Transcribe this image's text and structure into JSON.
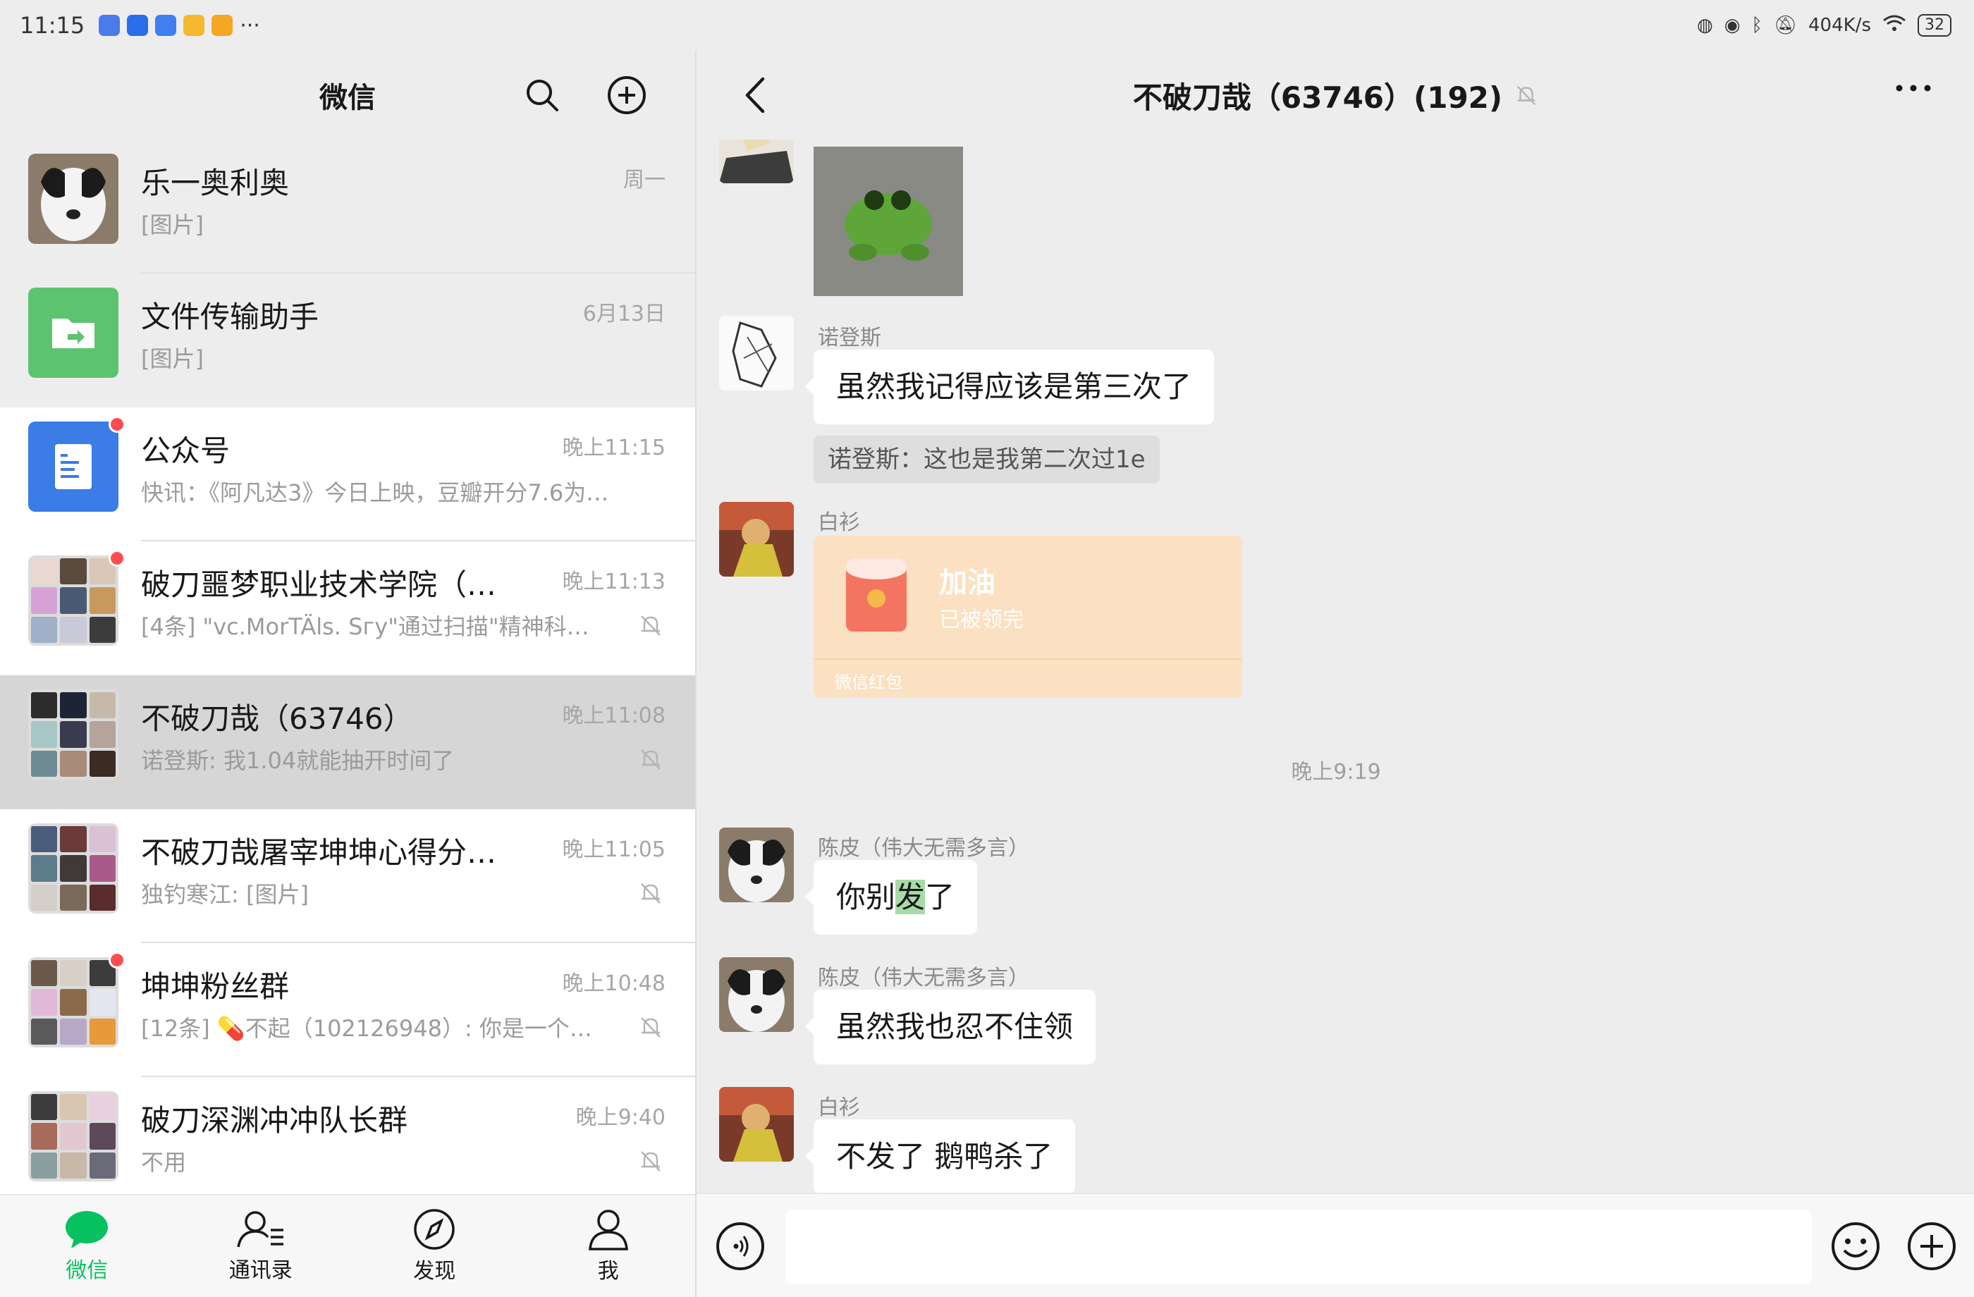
{
  "status_bar": {
    "time": "11:15",
    "ellipsis": "···",
    "net_speed": "404K/s",
    "battery": "32"
  },
  "left_header": {
    "title": "微信"
  },
  "chats": [
    {
      "name": "乐一奥利奥",
      "preview": "[图片]",
      "time": "周一",
      "muted": false,
      "unread": false
    },
    {
      "name": "文件传输助手",
      "preview": "[图片]",
      "time": "6月13日",
      "muted": false,
      "unread": false
    },
    {
      "name": "公众号",
      "preview": "快讯：《阿凡达3》今日上映，豆瓣开分7.6为…",
      "time": "晚上11:15",
      "muted": false,
      "unread": true
    },
    {
      "name": "破刀噩梦职业技术学院（…",
      "preview": "[4条] \"vc.MorTÄls. Sгу\"通过扫描\"精神科主…",
      "time": "晚上11:13",
      "muted": true,
      "unread": true
    },
    {
      "name": "不破刀哉（63746）",
      "preview": "诺登斯: 我1.04就能抽开时间了",
      "time": "晚上11:08",
      "muted": true,
      "unread": false
    },
    {
      "name": "不破刀哉屠宰坤坤心得分…",
      "preview": "独钓寒江: [图片]",
      "time": "晚上11:05",
      "muted": true,
      "unread": false
    },
    {
      "name": "坤坤粉丝群",
      "preview": "[12条] 💊不起（102126948）: 你是一个好人",
      "time": "晚上10:48",
      "muted": true,
      "unread": true
    },
    {
      "name": "破刀深渊冲冲队长群",
      "preview": "不用",
      "time": "晚上9:40",
      "muted": true,
      "unread": false
    }
  ],
  "tabs": [
    {
      "label": "微信",
      "icon": "chat-bubble-icon",
      "active": true
    },
    {
      "label": "通讯录",
      "icon": "contacts-icon",
      "active": false
    },
    {
      "label": "发现",
      "icon": "compass-icon",
      "active": false
    },
    {
      "label": "我",
      "icon": "person-icon",
      "active": false
    }
  ],
  "chat_header": {
    "title": "不破刀哉（63746）(192)"
  },
  "messages": {
    "m1_sender": "诺登斯",
    "m1_text": "虽然我记得应该是第三次了",
    "m1_quote": "诺登斯：这也是我第二次过1e",
    "m2_sender": "白衫",
    "m2_rp_title": "加油",
    "m2_rp_status": "已被领完",
    "m2_rp_label": "微信红包",
    "timestamp": "晚上9:19",
    "m3_sender": "陈皮（伟大无需多言）",
    "m3_pre": "你别",
    "m3_hl": "发",
    "m3_post": "了",
    "m4_sender": "陈皮（伟大无需多言）",
    "m4_text": "虽然我也忍不住领",
    "m5_sender": "白衫",
    "m5_text": "不发了 鹅鸭杀了"
  },
  "input": {
    "value": "",
    "placeholder": ""
  },
  "colors": {
    "accent_green": "#07c160",
    "unread_red": "#ff4d4f",
    "red_packet": "#fbe0c2",
    "file_helper_green": "#5cc46f",
    "official_blue": "#3b7ce6"
  }
}
